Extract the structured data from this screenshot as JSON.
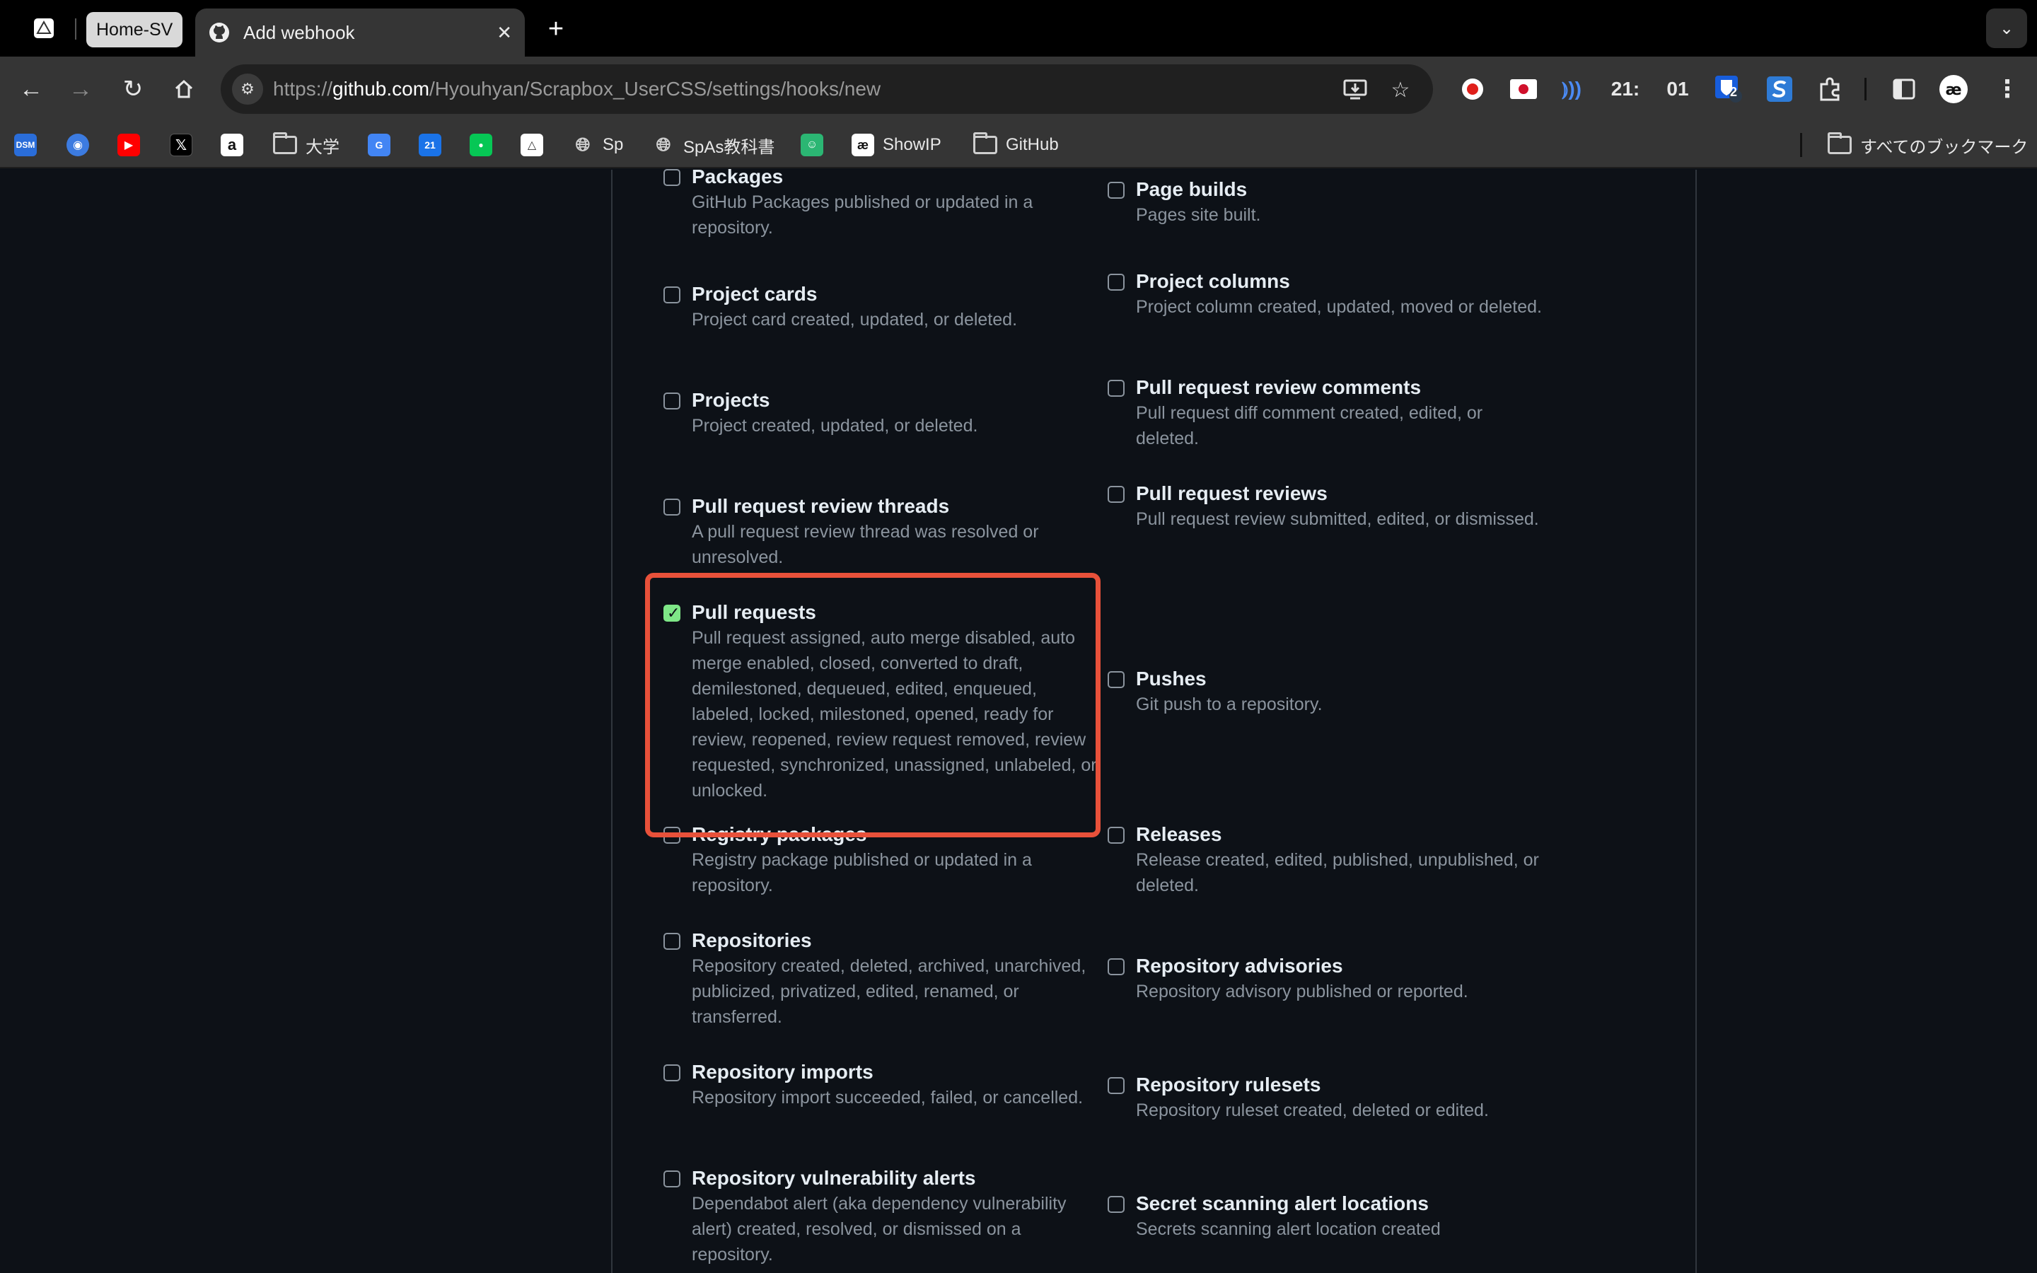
{
  "browser": {
    "pinned_tab_label": "Home-SV",
    "active_tab_title": "Add webhook",
    "url_scheme": "https://",
    "url_host": "github.com",
    "url_path": "/Hyouhyan/Scrapbox_UserCSS/settings/hooks/new",
    "clock_hours": "21:",
    "clock_minutes": "01",
    "badge_count": "2"
  },
  "bookmarks": [
    {
      "label": "",
      "icon": "dsm"
    },
    {
      "label": "",
      "icon": "globe-blue"
    },
    {
      "label": "",
      "icon": "youtube"
    },
    {
      "label": "",
      "icon": "x"
    },
    {
      "label": "",
      "icon": "amazon"
    },
    {
      "label": "大学",
      "icon": "folder"
    },
    {
      "label": "",
      "icon": "translate"
    },
    {
      "label": "",
      "icon": "calendar"
    },
    {
      "label": "",
      "icon": "line"
    },
    {
      "label": "",
      "icon": "triangle"
    },
    {
      "label": "Sp",
      "icon": "globe"
    },
    {
      "label": "SpAs教科書",
      "icon": "globe"
    },
    {
      "label": "",
      "icon": "green-app"
    },
    {
      "label": "ShowIP",
      "icon": "ae"
    },
    {
      "label": "GitHub",
      "icon": "folder"
    }
  ],
  "all_bookmarks_label": "すべてのブックマーク",
  "events": {
    "packages": {
      "title": "Packages",
      "desc": "GitHub Packages published or updated in a repository.",
      "checked": false
    },
    "page_builds": {
      "title": "Page builds",
      "desc": "Pages site built.",
      "checked": false
    },
    "project_cards": {
      "title": "Project cards",
      "desc": "Project card created, updated, or deleted.",
      "checked": false
    },
    "project_columns": {
      "title": "Project columns",
      "desc": "Project column created, updated, moved or deleted.",
      "checked": false
    },
    "projects": {
      "title": "Projects",
      "desc": "Project created, updated, or deleted.",
      "checked": false
    },
    "pr_review_comments": {
      "title": "Pull request review comments",
      "desc": "Pull request diff comment created, edited, or deleted.",
      "checked": false
    },
    "pr_review_threads": {
      "title": "Pull request review threads",
      "desc": "A pull request review thread was resolved or unresolved.",
      "checked": false
    },
    "pr_reviews": {
      "title": "Pull request reviews",
      "desc": "Pull request review submitted, edited, or dismissed.",
      "checked": false
    },
    "pull_requests": {
      "title": "Pull requests",
      "desc": "Pull request assigned, auto merge disabled, auto merge enabled, closed, converted to draft, demilestoned, dequeued, edited, enqueued, labeled, locked, milestoned, opened, ready for review, reopened, review request removed, review requested, synchronized, unassigned, unlabeled, or unlocked.",
      "checked": true
    },
    "pushes": {
      "title": "Pushes",
      "desc": "Git push to a repository.",
      "checked": false
    },
    "registry_packages": {
      "title": "Registry packages",
      "desc": "Registry package published or updated in a repository.",
      "checked": false
    },
    "releases": {
      "title": "Releases",
      "desc": "Release created, edited, published, unpublished, or deleted.",
      "checked": false
    },
    "repositories": {
      "title": "Repositories",
      "desc": "Repository created, deleted, archived, unarchived, publicized, privatized, edited, renamed, or transferred.",
      "checked": false
    },
    "repository_advisories": {
      "title": "Repository advisories",
      "desc": "Repository advisory published or reported.",
      "checked": false
    },
    "repository_imports": {
      "title": "Repository imports",
      "desc": "Repository import succeeded, failed, or cancelled.",
      "checked": false
    },
    "repository_rulesets": {
      "title": "Repository rulesets",
      "desc": "Repository ruleset created, deleted or edited.",
      "checked": false
    },
    "repo_vuln_alerts": {
      "title": "Repository vulnerability alerts",
      "desc": "Dependabot alert (aka dependency vulnerability alert) created, resolved, or dismissed on a repository.",
      "checked": false
    },
    "secret_scanning_locations": {
      "title": "Secret scanning alert locations",
      "desc": "Secrets scanning alert location created",
      "checked": false
    }
  },
  "colors": {
    "accent_checked": "#7ee787",
    "highlight_border": "#e8513a",
    "page_bg": "#0d1117"
  }
}
